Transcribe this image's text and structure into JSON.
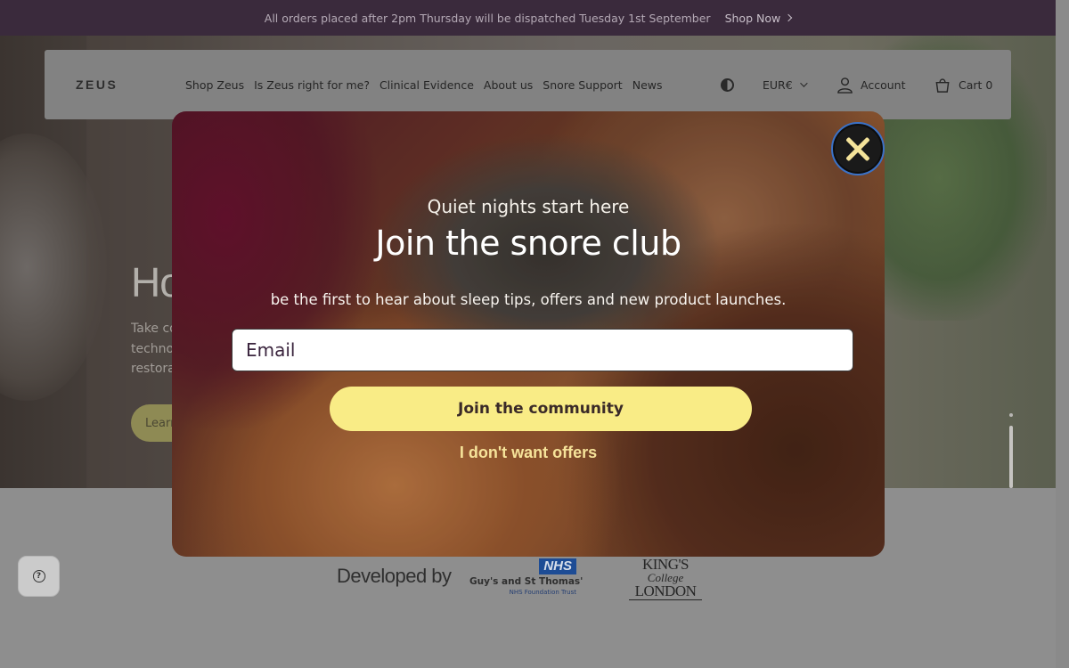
{
  "announcement": {
    "text": "All orders placed after 2pm Thursday will be dispatched Tuesday 1st September",
    "link": "Shop Now"
  },
  "header": {
    "logo": "ZEUS",
    "nav": [
      "Shop Zeus",
      "Is Zeus right for me?",
      "Clinical Evidence",
      "About us",
      "Snore Support",
      "News"
    ],
    "currency": "EUR€",
    "account": "Account",
    "cart": "Cart 0"
  },
  "hero": {
    "title": "Ho",
    "text_lines": [
      "Take co",
      "techno",
      "restora"
    ],
    "button": "Learn"
  },
  "partners": {
    "developed_by": "Developed by",
    "nhs_badge": "NHS",
    "nhs_name": "Guy's and St Thomas'",
    "nhs_sub": "NHS Foundation Trust",
    "kcl_line1": "KING'S",
    "kcl_line2": "College",
    "kcl_line3": "LONDON"
  },
  "modal": {
    "kicker": "Quiet nights start here",
    "title": "Join the snore club",
    "text": "be the first to hear about sleep tips, offers and new product launches.",
    "email_placeholder": "Email",
    "join": "Join the community",
    "decline": "I don't want offers"
  },
  "colors": {
    "announce_bg": "#3a2a3c",
    "join_button": "#f9ec86",
    "decline_text": "#f6e39a"
  },
  "icons": {
    "theme": "contrast-icon",
    "account": "user-icon",
    "cart": "basket-icon",
    "close": "close-icon",
    "help": "help-icon"
  }
}
